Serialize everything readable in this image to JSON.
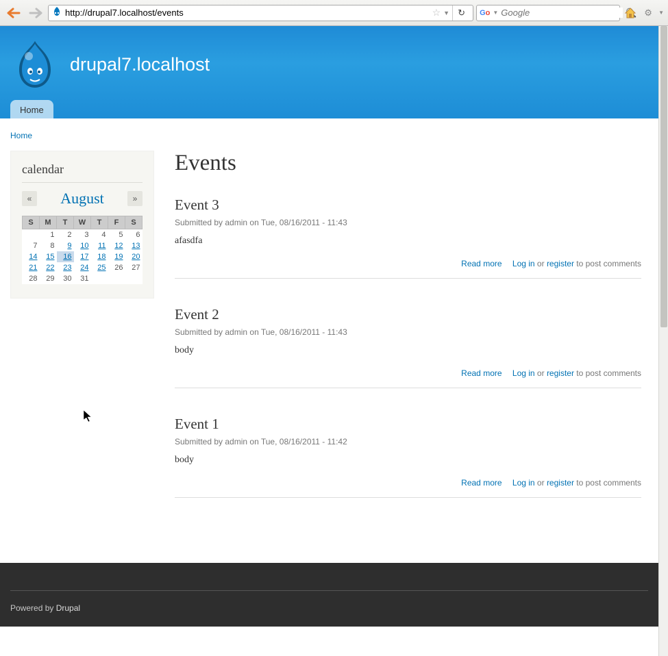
{
  "browser": {
    "url": "http://drupal7.localhost/events",
    "search_placeholder": "Google"
  },
  "site": {
    "name": "drupal7.localhost"
  },
  "menu": {
    "home": "Home"
  },
  "breadcrumb": {
    "home": "Home"
  },
  "calendar": {
    "title": "calendar",
    "prev": "«",
    "next": "»",
    "month": "August",
    "days": [
      "S",
      "M",
      "T",
      "W",
      "T",
      "F",
      "S"
    ],
    "weeks": [
      [
        {
          "n": ""
        },
        {
          "n": "1"
        },
        {
          "n": "2"
        },
        {
          "n": "3"
        },
        {
          "n": "4"
        },
        {
          "n": "5"
        },
        {
          "n": "6"
        }
      ],
      [
        {
          "n": "7"
        },
        {
          "n": "8"
        },
        {
          "n": "9",
          "link": true
        },
        {
          "n": "10",
          "link": true
        },
        {
          "n": "11",
          "link": true
        },
        {
          "n": "12",
          "link": true
        },
        {
          "n": "13",
          "link": true
        }
      ],
      [
        {
          "n": "14",
          "link": true
        },
        {
          "n": "15",
          "link": true
        },
        {
          "n": "16",
          "link": true,
          "today": true
        },
        {
          "n": "17",
          "link": true
        },
        {
          "n": "18",
          "link": true
        },
        {
          "n": "19",
          "link": true
        },
        {
          "n": "20",
          "link": true
        }
      ],
      [
        {
          "n": "21",
          "link": true
        },
        {
          "n": "22",
          "link": true
        },
        {
          "n": "23",
          "link": true
        },
        {
          "n": "24",
          "link": true
        },
        {
          "n": "25",
          "link": true
        },
        {
          "n": "26"
        },
        {
          "n": "27"
        }
      ],
      [
        {
          "n": "28"
        },
        {
          "n": "29"
        },
        {
          "n": "30"
        },
        {
          "n": "31"
        },
        {
          "n": ""
        },
        {
          "n": ""
        },
        {
          "n": ""
        }
      ]
    ]
  },
  "page": {
    "title": "Events",
    "read_more": "Read more",
    "log_in": "Log in",
    "register": "register",
    "or": "or",
    "to_post": "to post comments",
    "submitted_by_label": "Submitted by",
    "on_label": "on"
  },
  "events": [
    {
      "title": "Event 3",
      "author": "admin",
      "date": "Tue, 08/16/2011 - 11:43",
      "body": "afasdfa"
    },
    {
      "title": "Event 2",
      "author": "admin",
      "date": "Tue, 08/16/2011 - 11:43",
      "body": "body"
    },
    {
      "title": "Event 1",
      "author": "admin",
      "date": "Tue, 08/16/2011 - 11:42",
      "body": "body"
    }
  ],
  "footer": {
    "powered": "Powered by",
    "drupal": "Drupal"
  }
}
